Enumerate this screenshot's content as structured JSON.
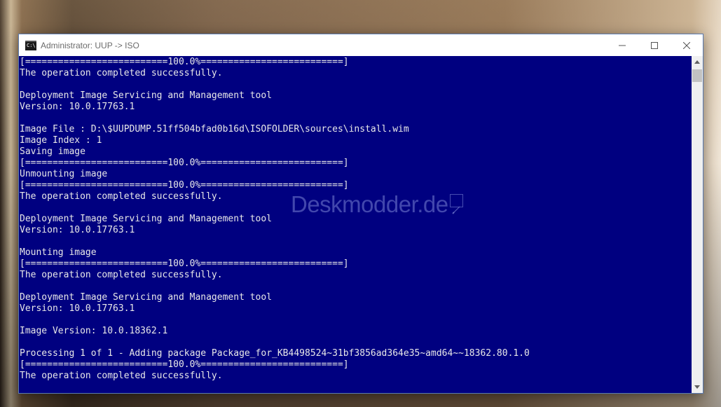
{
  "window": {
    "title": "Administrator:  UUP -> ISO",
    "icon_text": "C:\\",
    "icons": {
      "app": "console-icon",
      "minimize": "minimize-icon",
      "maximize": "maximize-icon",
      "close": "close-icon"
    }
  },
  "console": {
    "background": "#000080",
    "foreground": "#e8e8e8",
    "lines": [
      "[==========================100.0%==========================]",
      "The operation completed successfully.",
      "",
      "Deployment Image Servicing and Management tool",
      "Version: 10.0.17763.1",
      "",
      "Image File : D:\\$UUPDUMP.51ff504bfad0b16d\\ISOFOLDER\\sources\\install.wim",
      "Image Index : 1",
      "Saving image",
      "[==========================100.0%==========================]",
      "Unmounting image",
      "[==========================100.0%==========================]",
      "The operation completed successfully.",
      "",
      "Deployment Image Servicing and Management tool",
      "Version: 10.0.17763.1",
      "",
      "Mounting image",
      "[==========================100.0%==========================]",
      "The operation completed successfully.",
      "",
      "Deployment Image Servicing and Management tool",
      "Version: 10.0.17763.1",
      "",
      "Image Version: 10.0.18362.1",
      "",
      "Processing 1 of 1 - Adding package Package_for_KB4498524~31bf3856ad364e35~amd64~~18362.80.1.0",
      "[==========================100.0%==========================]",
      "The operation completed successfully."
    ]
  },
  "watermark": {
    "text": "Deskmodder.de"
  },
  "scrollbar": {
    "up_icon": "scroll-up-arrow-icon",
    "down_icon": "scroll-down-arrow-icon"
  }
}
